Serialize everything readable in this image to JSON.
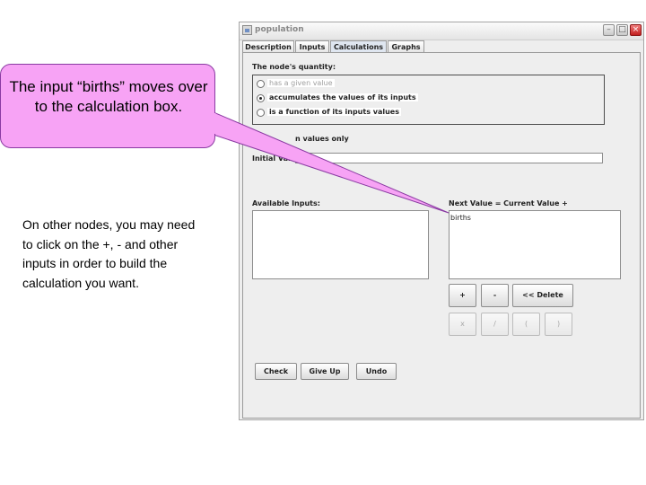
{
  "window": {
    "title": "population",
    "tabs": [
      "Description",
      "Inputs",
      "Calculations",
      "Graphs"
    ],
    "active_tab": "Calculations"
  },
  "calculations": {
    "quantity_label": "The node's quantity:",
    "options": [
      {
        "label": "has a given value",
        "state": "disabled"
      },
      {
        "label": "accumulates the values of its inputs",
        "state": "selected"
      },
      {
        "label": "is a function of its inputs values",
        "state": "unselected"
      }
    ],
    "partial_label": "n values only",
    "initial_value_label": "Initial Value",
    "initial_value": "",
    "available_inputs_label": "Available Inputs:",
    "next_value_label": "Next Value = Current Value +",
    "next_value_content": "births",
    "op_buttons": [
      "+",
      "-",
      "<< Delete"
    ],
    "op_buttons_disabled": [
      "x",
      "/",
      "(",
      ")"
    ],
    "action_buttons": [
      "Check",
      "Give Up",
      "Undo"
    ]
  },
  "callout": {
    "text": "The input “births” moves over to the calculation box."
  },
  "note": {
    "text": "On other nodes, you may need to click on the +, - and other inputs in order to build the calculation you want."
  },
  "colors": {
    "callout_fill": "#f7a3f5",
    "callout_border": "#8a3aa2",
    "window_bg": "#eeeeee",
    "close_button": "#c21f1f"
  }
}
